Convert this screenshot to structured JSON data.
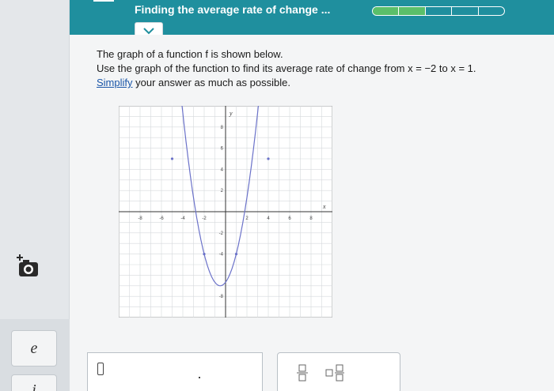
{
  "header": {
    "title": "Finding the average rate of change ...",
    "progress_total": 5,
    "progress_done": 2
  },
  "problem": {
    "line1": "The graph of a function f is shown below.",
    "line2": "Use the graph of the function to find its average rate of change from x = −2 to x = 1.",
    "line3_link": "Simplify",
    "line3_rest": " your answer as much as possible."
  },
  "graph": {
    "x_label": "x",
    "y_label": "y",
    "x_ticks": [
      "-8",
      "-6",
      "-4",
      "-2",
      "2",
      "4",
      "6",
      "8"
    ],
    "y_ticks": [
      "8",
      "6",
      "4",
      "2",
      "-2",
      "-4",
      "-8"
    ],
    "xlim": [
      -10,
      10
    ],
    "ylim": [
      -10,
      10
    ],
    "curve_vertex": [
      -0.5,
      -7
    ],
    "highlight_points": [
      [
        -2,
        -4
      ],
      [
        1,
        -4
      ],
      [
        -5,
        5
      ],
      [
        4,
        5
      ]
    ]
  },
  "keypad": {
    "key_e": "e",
    "key_i": "i"
  },
  "icons": {
    "camera": "add-photo-icon",
    "chevron": "chevron-down-icon",
    "fraction": "fraction-icon",
    "mixed_number": "mixed-number-icon"
  },
  "colors": {
    "header": "#1f8f9e",
    "progress_done": "#5bbf6a",
    "curve": "#6b72c9"
  }
}
